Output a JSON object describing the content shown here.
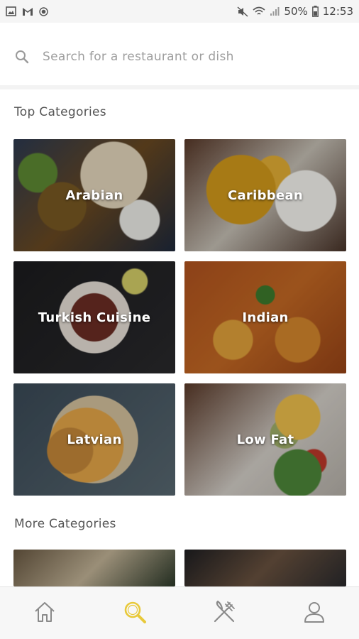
{
  "status_bar": {
    "battery": "50%",
    "time": "12:53"
  },
  "search": {
    "placeholder": "Search for a restaurant or dish"
  },
  "sections": {
    "top_title": "Top Categories",
    "more_title": "More Categories"
  },
  "top_categories": [
    {
      "label": "Arabian"
    },
    {
      "label": "Caribbean"
    },
    {
      "label": "Turkish Cuisine"
    },
    {
      "label": "Indian"
    },
    {
      "label": "Latvian"
    },
    {
      "label": "Low Fat"
    }
  ],
  "colors": {
    "active_nav": "#e8c93a",
    "inactive_nav": "#8a8a8a"
  },
  "bottom_nav": [
    {
      "icon": "home-icon",
      "active": false
    },
    {
      "icon": "search-icon",
      "active": true
    },
    {
      "icon": "fork-knife-icon",
      "active": false
    },
    {
      "icon": "profile-icon",
      "active": false
    }
  ]
}
